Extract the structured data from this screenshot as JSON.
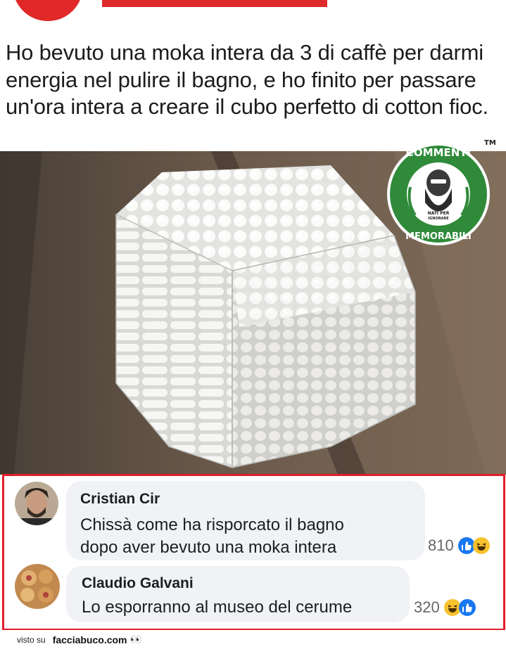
{
  "post": {
    "text": "Ho bevuto una moka intera da 3 di caffè per darmi energia nel pulire il bagno, e ho finito per passare un'ora intera a creare il cubo perfetto di cotton fioc."
  },
  "logo": {
    "top_text": "COMMENTI",
    "bottom_text": "MEMORABILI",
    "sub_text_1": "NATI PER",
    "sub_text_2": "IGNORARE",
    "tm": "TM"
  },
  "comments": [
    {
      "author": "Cristian Cir",
      "line1": "Chissà come ha risporcato il bagno",
      "line2": "dopo aver bevuto una moka intera",
      "reaction_count": "810"
    },
    {
      "author": "Claudio Galvani",
      "line1": "Lo esporranno al museo del cerume",
      "reaction_count": "320"
    }
  ],
  "footer": {
    "label": "visto su",
    "site": "facciabuco.com"
  },
  "colors": {
    "accent_red": "#e21d2a",
    "logo_green": "#2f8a3a",
    "like_blue": "#1877f2",
    "haha_yellow": "#f7c22e"
  }
}
